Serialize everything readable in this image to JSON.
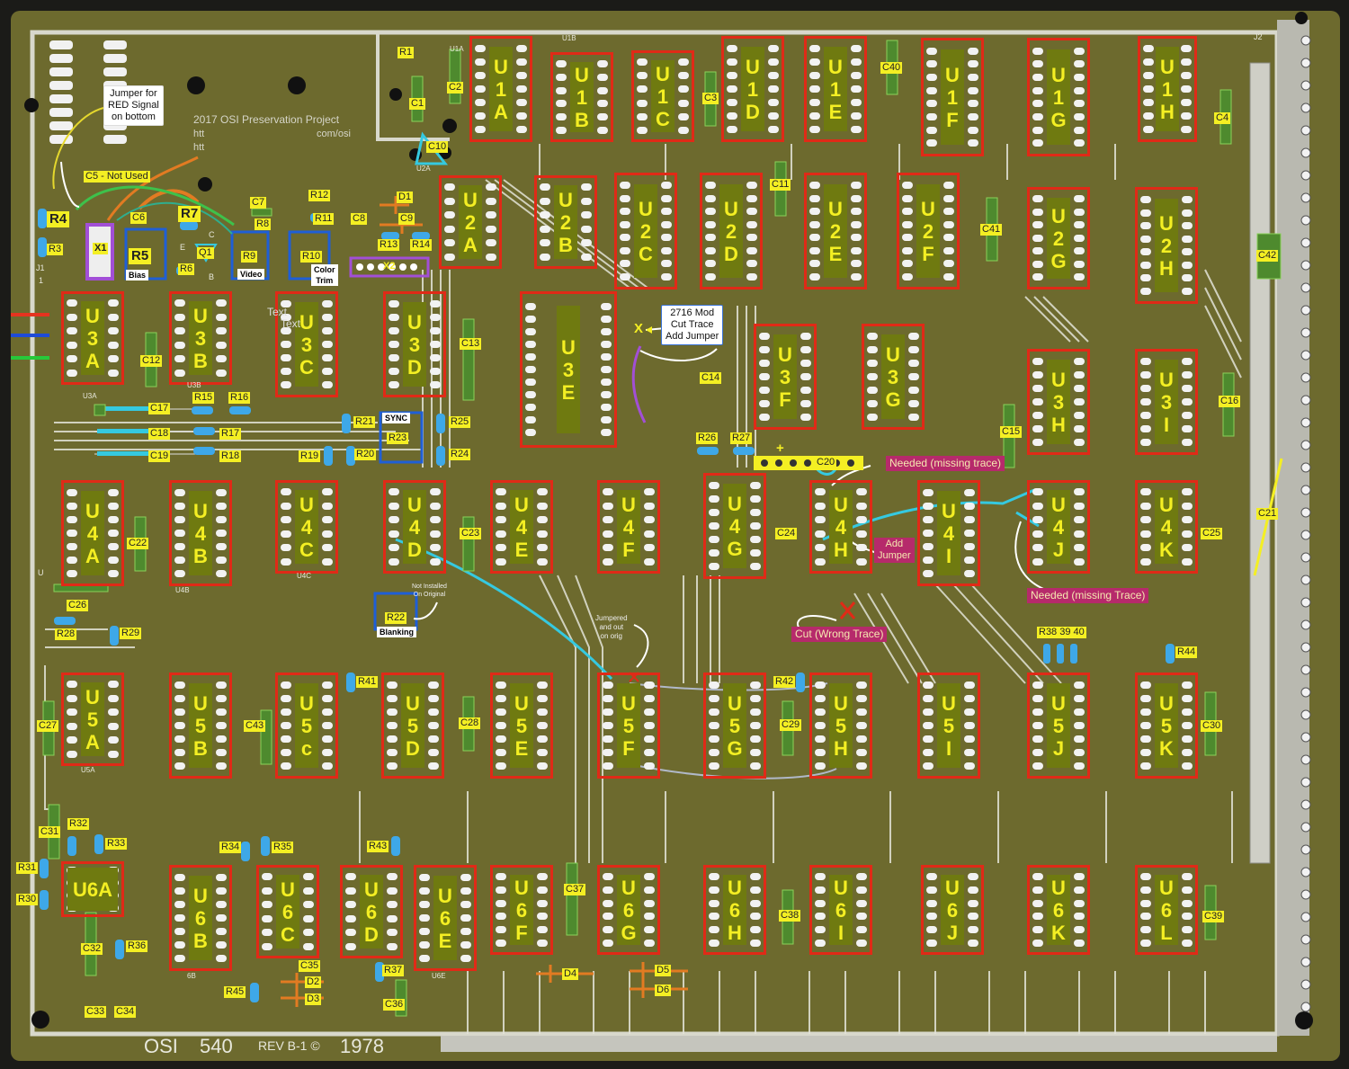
{
  "colors": {
    "board": "#6d6a2e",
    "trace": "#e6e6e6",
    "chip_outline": "#e02a17",
    "label_bg": "#f4ef23",
    "callout_bg": "#b62a6b",
    "jumper_cyan": "#35c9e0",
    "jumper_purple": "#a24fd6"
  },
  "silkscreen": {
    "project": "2017 OSI Preservation Project",
    "url_line1": "htt",
    "url_line2": "htt",
    "url_tail": "com/osi",
    "brand": "OSI",
    "model": "540",
    "rev": "REV B-1 ©",
    "year": "1978",
    "text1": "Text",
    "text2": "Text"
  },
  "notes": {
    "jumper_red": "Jumper for\nRED Signal\non bottom",
    "mod_2716": "2716 Mod\nCut Trace\nAdd Jumper",
    "not_installed": "Not Installed\nOn Original",
    "jumpered": "Jumpered\nand out\non orig",
    "needed_missing_trace_lower": "Needed (missing trace)",
    "needed_missing_trace_cap": "Needed (missing Trace)",
    "add_jumper": "Add\nJumper",
    "cut_wrong_trace": "Cut (Wrong Trace)"
  },
  "tags": {
    "bias": "Bias",
    "video": "Video",
    "color_trim": "Color\nTrim",
    "sync": "SYNC",
    "blanking": "Blanking"
  },
  "chips": [
    {
      "id": "U1A",
      "chars": [
        "U",
        "1",
        "A"
      ]
    },
    {
      "id": "U1B",
      "chars": [
        "U",
        "1",
        "B"
      ]
    },
    {
      "id": "U1C",
      "chars": [
        "U",
        "1",
        "C"
      ]
    },
    {
      "id": "U1D",
      "chars": [
        "U",
        "1",
        "D"
      ]
    },
    {
      "id": "U1E",
      "chars": [
        "U",
        "1",
        "E"
      ]
    },
    {
      "id": "U1F",
      "chars": [
        "U",
        "1",
        "F"
      ]
    },
    {
      "id": "U1G",
      "chars": [
        "U",
        "1",
        "G"
      ]
    },
    {
      "id": "U1H",
      "chars": [
        "U",
        "1",
        "H"
      ]
    },
    {
      "id": "U2A",
      "chars": [
        "U",
        "2",
        "A"
      ]
    },
    {
      "id": "U2B",
      "chars": [
        "U",
        "2",
        "B"
      ]
    },
    {
      "id": "U2C",
      "chars": [
        "U",
        "2",
        "C"
      ]
    },
    {
      "id": "U2D",
      "chars": [
        "U",
        "2",
        "D"
      ]
    },
    {
      "id": "U2E",
      "chars": [
        "U",
        "2",
        "E"
      ]
    },
    {
      "id": "U2F",
      "chars": [
        "U",
        "2",
        "F"
      ]
    },
    {
      "id": "U2G",
      "chars": [
        "U",
        "2",
        "G"
      ]
    },
    {
      "id": "U2H",
      "chars": [
        "U",
        "2",
        "H"
      ]
    },
    {
      "id": "U3A",
      "chars": [
        "U",
        "3",
        "A"
      ]
    },
    {
      "id": "U3B",
      "chars": [
        "U",
        "3",
        "B"
      ]
    },
    {
      "id": "U3C",
      "chars": [
        "U",
        "3",
        "C"
      ]
    },
    {
      "id": "U3D",
      "chars": [
        "U",
        "3",
        "D"
      ]
    },
    {
      "id": "U3E",
      "chars": [
        "U",
        "3",
        "E"
      ]
    },
    {
      "id": "U3F",
      "chars": [
        "U",
        "3",
        "F"
      ]
    },
    {
      "id": "U3G",
      "chars": [
        "U",
        "3",
        "G"
      ]
    },
    {
      "id": "U3H",
      "chars": [
        "U",
        "3",
        "H"
      ]
    },
    {
      "id": "U3I",
      "chars": [
        "U",
        "3",
        "I"
      ]
    },
    {
      "id": "U4A",
      "chars": [
        "U",
        "4",
        "A"
      ]
    },
    {
      "id": "U4B",
      "chars": [
        "U",
        "4",
        "B"
      ]
    },
    {
      "id": "U4C",
      "chars": [
        "U",
        "4",
        "C"
      ]
    },
    {
      "id": "U4D",
      "chars": [
        "U",
        "4",
        "D"
      ]
    },
    {
      "id": "U4E",
      "chars": [
        "U",
        "4",
        "E"
      ]
    },
    {
      "id": "U4F",
      "chars": [
        "U",
        "4",
        "F"
      ]
    },
    {
      "id": "U4G",
      "chars": [
        "U",
        "4",
        "G"
      ]
    },
    {
      "id": "U4H",
      "chars": [
        "U",
        "4",
        "H"
      ]
    },
    {
      "id": "U4I",
      "chars": [
        "U",
        "4",
        "I"
      ]
    },
    {
      "id": "U4J",
      "chars": [
        "U",
        "4",
        "J"
      ]
    },
    {
      "id": "U4K",
      "chars": [
        "U",
        "4",
        "K"
      ]
    },
    {
      "id": "U5A",
      "chars": [
        "U",
        "5",
        "A"
      ]
    },
    {
      "id": "U5B",
      "chars": [
        "U",
        "5",
        "B"
      ]
    },
    {
      "id": "U5c",
      "chars": [
        "U",
        "5",
        "c"
      ]
    },
    {
      "id": "U5D",
      "chars": [
        "U",
        "5",
        "D"
      ]
    },
    {
      "id": "U5E",
      "chars": [
        "U",
        "5",
        "E"
      ]
    },
    {
      "id": "U5F",
      "chars": [
        "U",
        "5",
        "F"
      ]
    },
    {
      "id": "U5G",
      "chars": [
        "U",
        "5",
        "G"
      ]
    },
    {
      "id": "U5H",
      "chars": [
        "U",
        "5",
        "H"
      ]
    },
    {
      "id": "U5I",
      "chars": [
        "U",
        "5",
        "I"
      ]
    },
    {
      "id": "U5J",
      "chars": [
        "U",
        "5",
        "J"
      ]
    },
    {
      "id": "U5K",
      "chars": [
        "U",
        "5",
        "K"
      ]
    },
    {
      "id": "U6A",
      "chars": [
        "U6A"
      ]
    },
    {
      "id": "U6B",
      "chars": [
        "U",
        "6",
        "B"
      ]
    },
    {
      "id": "U6C",
      "chars": [
        "U",
        "6",
        "C"
      ]
    },
    {
      "id": "U6D",
      "chars": [
        "U",
        "6",
        "D"
      ]
    },
    {
      "id": "U6E",
      "chars": [
        "U",
        "6",
        "E"
      ]
    },
    {
      "id": "U6F",
      "chars": [
        "U",
        "6",
        "F"
      ]
    },
    {
      "id": "U6G",
      "chars": [
        "U",
        "6",
        "G"
      ]
    },
    {
      "id": "U6H",
      "chars": [
        "U",
        "6",
        "H"
      ]
    },
    {
      "id": "U6I",
      "chars": [
        "U",
        "6",
        "I"
      ]
    },
    {
      "id": "U6J",
      "chars": [
        "U",
        "6",
        "J"
      ]
    },
    {
      "id": "U6K",
      "chars": [
        "U",
        "6",
        "K"
      ]
    },
    {
      "id": "U6L",
      "chars": [
        "U",
        "6",
        "L"
      ]
    }
  ],
  "labels": {
    "R1": "R1",
    "R3": "R3",
    "R4": "R4",
    "R5": "R5",
    "R6": "R6",
    "R7": "R7",
    "R8": "R8",
    "R9": "R9",
    "R10": "R10",
    "R11": "R11",
    "R12": "R12",
    "R13": "R13",
    "R14": "R14",
    "R15": "R15",
    "R16": "R16",
    "R17": "R17",
    "R18": "R18",
    "R19": "R19",
    "R20": "R20",
    "R21": "R21",
    "R22": "R22",
    "R23": "R23",
    "R24": "R24",
    "R25": "R25",
    "R26": "R26",
    "R27": "R27",
    "R28": "R28",
    "R29": "R29",
    "R30": "R30",
    "R31": "R31",
    "R32": "R32",
    "R33": "R33",
    "R34": "R34",
    "R35": "R35",
    "R36": "R36",
    "R37": "R37",
    "R38_40": "R38 39 40",
    "R41": "R41",
    "R42": "R42",
    "R43": "R43",
    "R44": "R44",
    "R45": "R45",
    "C1": "C1",
    "C2": "C2",
    "C3": "C3",
    "C4": "C4",
    "C5": "C5 - Not Used",
    "C6": "C6",
    "C7": "C7",
    "C8": "C8",
    "C9": "C9",
    "C10": "C10",
    "C11": "C11",
    "C12": "C12",
    "C13": "C13",
    "C14": "C14",
    "C15": "C15",
    "C16": "C16",
    "C17": "C17",
    "C18": "C18",
    "C19": "C19",
    "C20": "C20",
    "C21": "C21",
    "C22": "C22",
    "C23": "C23",
    "C24": "C24",
    "C25": "C25",
    "C26": "C26",
    "C27": "C27",
    "C28": "C28",
    "C29": "C29",
    "C30": "C30",
    "C31": "C31",
    "C32": "C32",
    "C33": "C33",
    "C34": "C34",
    "C35": "C35",
    "C36": "C36",
    "C37": "C37",
    "C38": "C38",
    "C39": "C39",
    "C40": "C40",
    "C41": "C41",
    "C42": "C42",
    "C43": "C43",
    "D1": "D1",
    "D2": "D2",
    "D3": "D3",
    "D4": "D4",
    "D5": "D5",
    "D6": "D6",
    "Q1": "Q1",
    "X1": "X1",
    "X2": "X2",
    "plus": "+",
    "X_mark": "X"
  },
  "silk_small": {
    "U1A": "U1A",
    "U1B": "U1B",
    "U2A": "U2A",
    "U3A": "U3A",
    "U3B": "U3B",
    "U5A": "U5A",
    "U6E": "U6E",
    "U4B": "U4B",
    "U4C": "U4C",
    "J1": "J1",
    "J2": "J2",
    "E": "E",
    "C": "C",
    "B": "B",
    "six_b": "6B",
    "one": "1",
    "U": "U"
  }
}
